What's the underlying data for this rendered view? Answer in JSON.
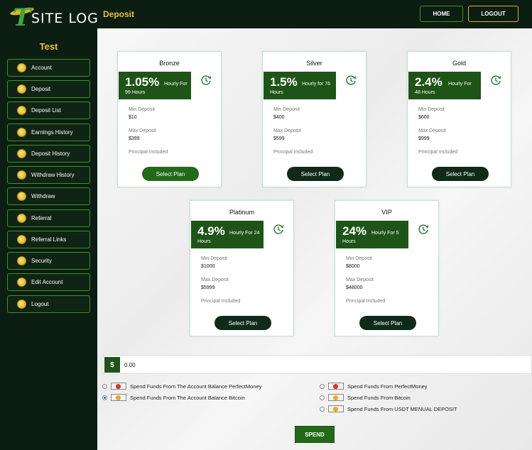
{
  "brand": {
    "letter": "T",
    "text": "SITE LOGO"
  },
  "user": {
    "name": "Test"
  },
  "header": {
    "title": "Deposit",
    "home_label": "HOME",
    "logout_label": "LOGOUT"
  },
  "sidebar": {
    "items": [
      {
        "label": "Account"
      },
      {
        "label": "Deposit"
      },
      {
        "label": "Deposit List"
      },
      {
        "label": "Earnings History"
      },
      {
        "label": "Deposit History"
      },
      {
        "label": "Withdraw History"
      },
      {
        "label": "Withdraw"
      },
      {
        "label": "Referral"
      },
      {
        "label": "Referral Links"
      },
      {
        "label": "Security"
      },
      {
        "label": "Edit Account"
      },
      {
        "label": "Logout"
      }
    ]
  },
  "labels": {
    "min_deposit": "Min Deposit",
    "max_deposit": "Max Deposit",
    "principal": "Principal Included",
    "select_plan": "Select Plan"
  },
  "plans": [
    {
      "name": "Bronze",
      "rate": "1.05%",
      "per": "Hourly For",
      "duration": "99 Hours",
      "min": "$10",
      "max": "$399"
    },
    {
      "name": "Silver",
      "rate": "1.5%",
      "per": "Hourly for 76",
      "duration": "Hours",
      "min": "$400",
      "max": "$599"
    },
    {
      "name": "Gold",
      "rate": "2.4%",
      "per": "Hourly For",
      "duration": "48 Hours",
      "min": "$600",
      "max": "$999"
    },
    {
      "name": "Platinum",
      "rate": "4.9%",
      "per": "Hourly For 24",
      "duration": "Hours",
      "min": "$1000",
      "max": "$5999"
    },
    {
      "name": "VIP",
      "rate": "24%",
      "per": "Hourly For 5",
      "duration": "Hours",
      "min": "$8000",
      "max": "$48000"
    }
  ],
  "amount": {
    "symbol": "$",
    "value": "0.00"
  },
  "funding_options": [
    {
      "label": "Spend Funds From The Account Balance PerfectMoney",
      "selected": false,
      "icon": "perfectmoney-icon"
    },
    {
      "label": "Spend Funds From The Account Balance Bitcoin",
      "selected": true,
      "icon": "bitcoin-icon"
    },
    {
      "label": "Spend Funds From PerfectMoney",
      "selected": false,
      "icon": "perfectmoney-icon"
    },
    {
      "label": "Spend Funds From Bitcoin",
      "selected": false,
      "icon": "bitcoin-icon"
    },
    {
      "label": "Spend Funds From USDT MENUAL DEPOSIT",
      "selected": false,
      "icon": "usdt-icon"
    }
  ],
  "spend_label": "SPEND",
  "colors": {
    "sidebar_bg": "#0c1d11",
    "accent_green": "#1e5417",
    "gold": "#e4c63a"
  }
}
